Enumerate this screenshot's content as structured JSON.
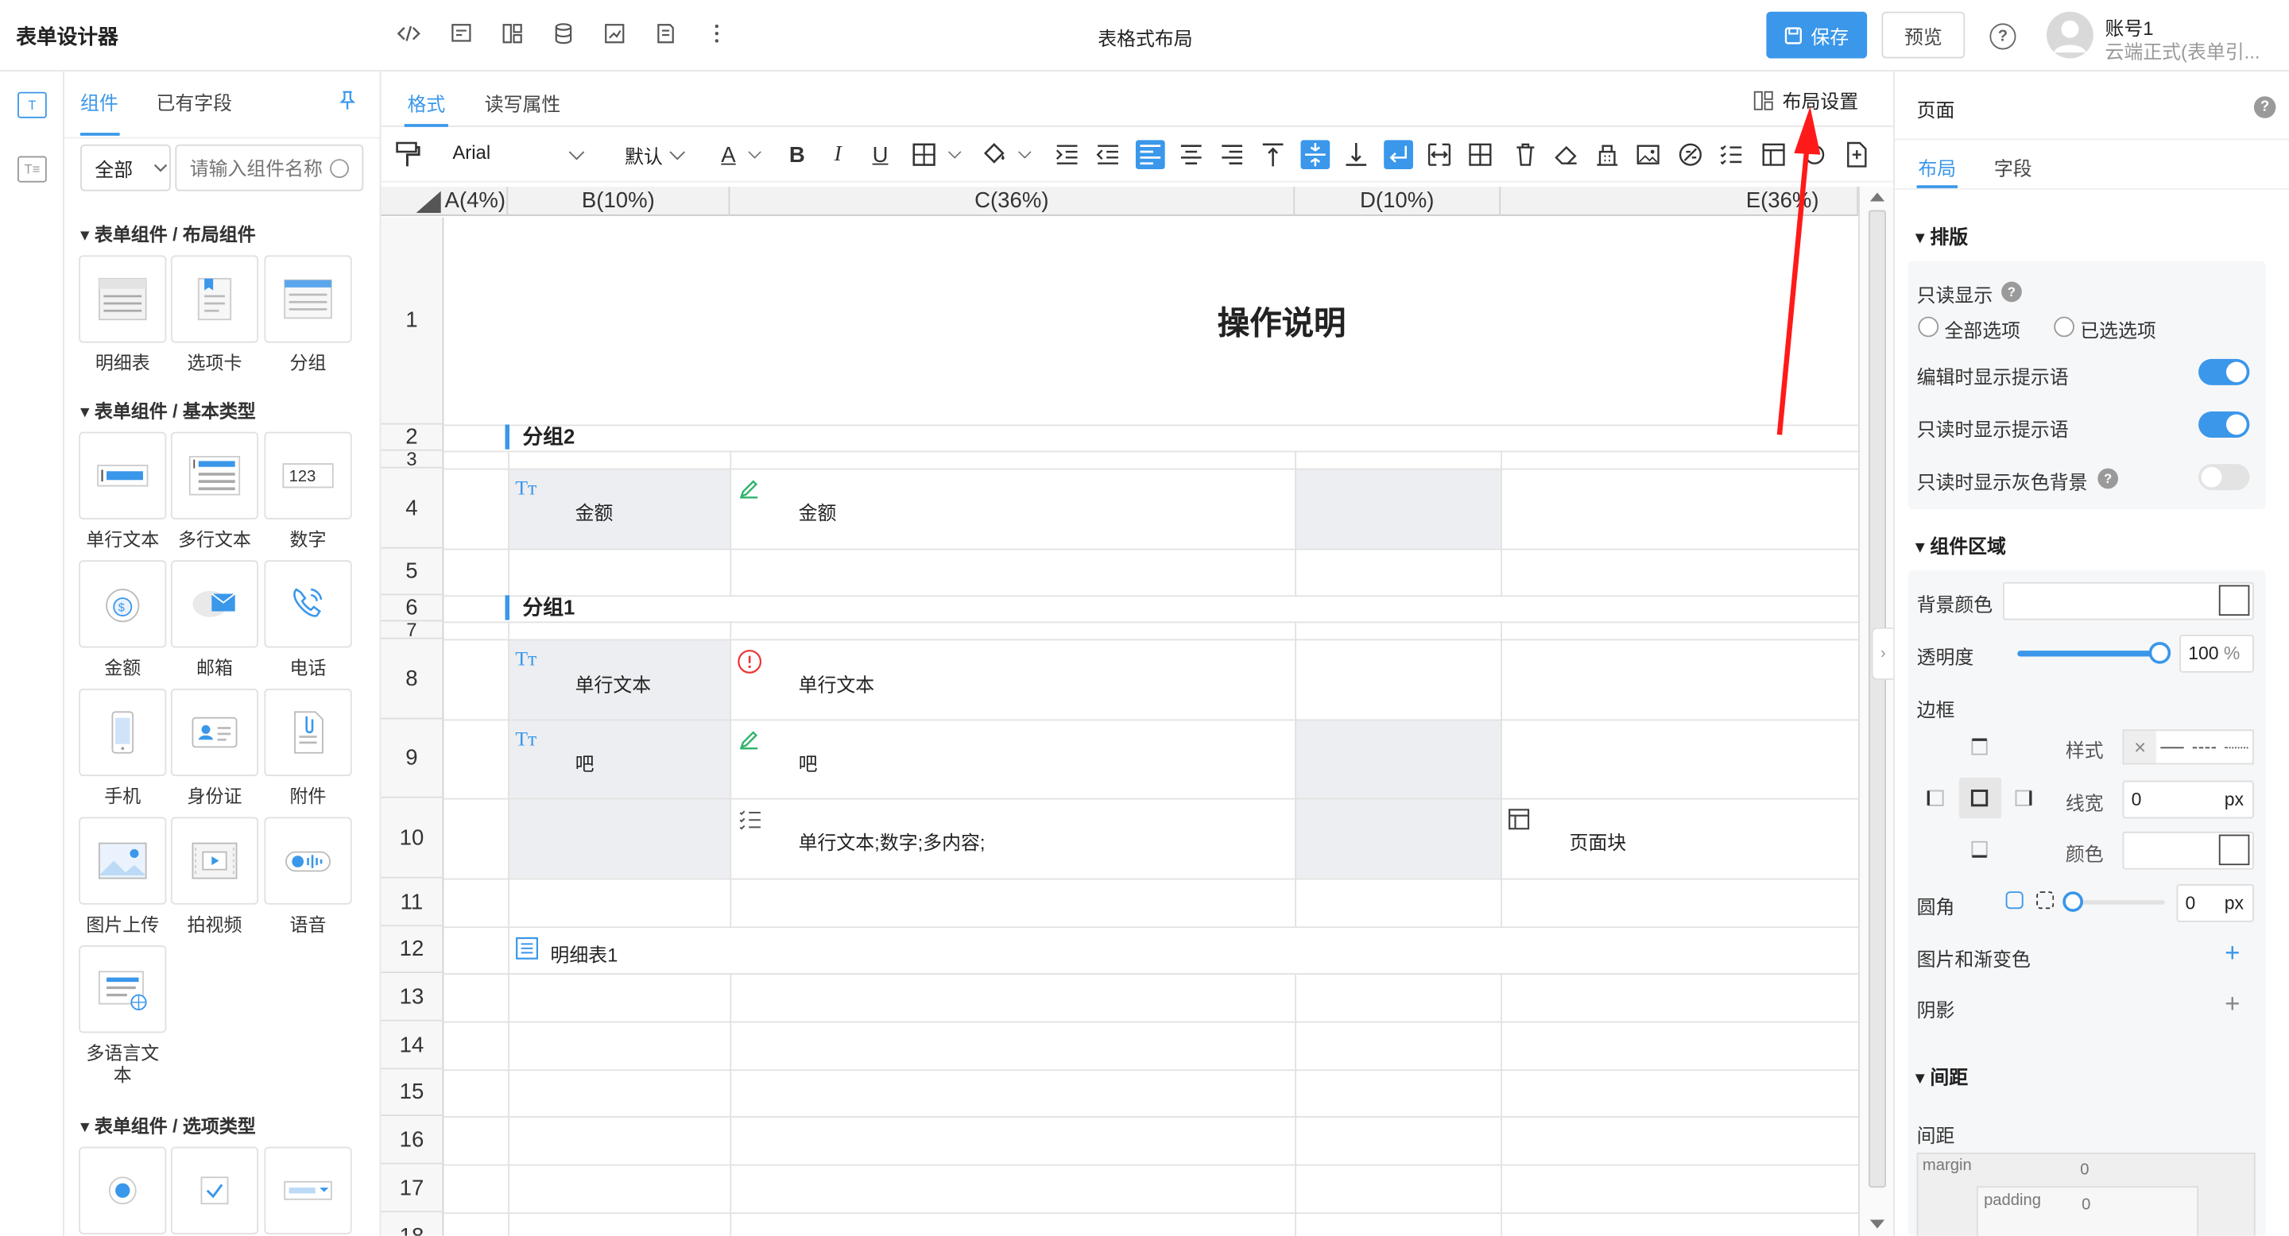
{
  "header": {
    "app_title": "表单设计器",
    "doc_title": "表格式布局",
    "save_label": "保存",
    "preview_label": "预览",
    "help_symbol": "?",
    "account_name": "账号1",
    "account_sub": "云端正式(表单引..."
  },
  "left_panel": {
    "tabs": [
      "组件",
      "已有字段"
    ],
    "scope": "全部",
    "search_placeholder": "请输入组件名称",
    "categories": [
      {
        "title": "表单组件 / 布局组件",
        "items": [
          "明细表",
          "选项卡",
          "分组"
        ]
      },
      {
        "title": "表单组件 / 基本类型",
        "items": [
          "单行文本",
          "多行文本",
          "数字",
          "金额",
          "邮箱",
          "电话",
          "手机",
          "身份证",
          "附件",
          "图片上传",
          "拍视频",
          "语音",
          "多语言文本"
        ]
      },
      {
        "title": "表单组件 / 选项类型",
        "items": []
      }
    ],
    "number_icon_text": "123"
  },
  "center": {
    "tabs": [
      "格式",
      "读写属性"
    ],
    "layout_settings_label": "布局设置",
    "toolbar": {
      "font": "Arial",
      "size": "默认"
    },
    "columns": [
      "A(4%)",
      "B(10%)",
      "C(36%)",
      "D(10%)",
      "E(36%)"
    ],
    "rows": [
      "1",
      "2",
      "3",
      "4",
      "5",
      "6",
      "7",
      "8",
      "9",
      "10",
      "11",
      "12",
      "13",
      "14",
      "15",
      "16",
      "17",
      "18"
    ],
    "cells": {
      "title": "操作说明",
      "group2": "分组2",
      "group1": "分组1",
      "r4_label": "金额",
      "r4_field": "金额",
      "r8_label": "单行文本",
      "r8_field": "单行文本",
      "r9_label": "吧",
      "r9_field": "吧",
      "r10_field": "单行文本;数字;多内容;",
      "r10_block": "页面块",
      "r12_detail": "明细表1"
    }
  },
  "right_panel": {
    "title": "页面",
    "tabs": [
      "布局",
      "字段"
    ],
    "section_layout": "排版",
    "readonly_display": "只读显示",
    "radio_all": "全部选项",
    "radio_selected": "已选选项",
    "edit_hint": "编辑时显示提示语",
    "read_hint": "只读时显示提示语",
    "read_gray": "只读时显示灰色背景",
    "toggles": {
      "edit_hint": true,
      "read_hint": true,
      "read_gray": false
    },
    "section_area": "组件区域",
    "bg_color": "背景颜色",
    "opacity_label": "透明度",
    "opacity_value": "100",
    "opacity_unit": "%",
    "opacity_fraction": 1.0,
    "border_label": "边框",
    "style_label": "样式",
    "line_width_label": "线宽",
    "line_width_value": "0",
    "color_label": "颜色",
    "radius_label": "圆角",
    "radius_value": "0",
    "px": "px",
    "image_gradient": "图片和渐变色",
    "shadow": "阴影",
    "section_spacing": "间距",
    "spacing_label": "间距",
    "margin_label": "margin",
    "margin_value": "0",
    "padding_label": "padding",
    "padding_value": "0"
  },
  "colors": {
    "accent": "#3a97ea",
    "annotation_arrow": "#ff1a1a"
  }
}
